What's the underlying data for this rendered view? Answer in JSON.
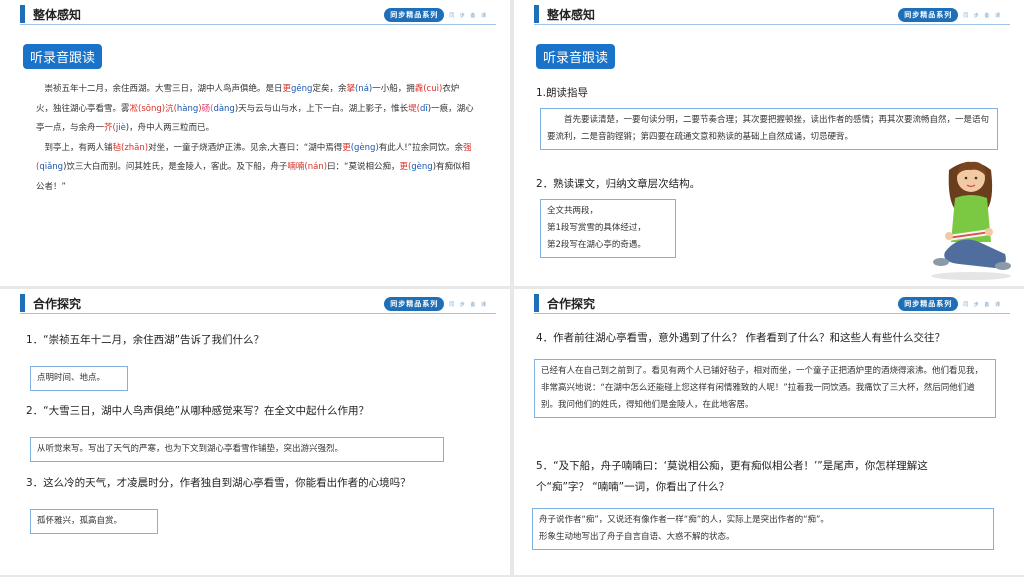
{
  "brand": {
    "tag": "同步精品系列",
    "sub": "同 步 备 课"
  },
  "panel1": {
    "section_title": "整体感知",
    "pill": "听录音跟读",
    "passage": {
      "l1a": "崇祯五年十二月，余住西湖。大雪三日，湖中人鸟声俱绝。是日",
      "l1b": "更",
      "l1c": "gēng",
      "l1d": "定矣，余",
      "l1e": "拏",
      "l1f": "(ná)",
      "l2a": "一小船，拥",
      "l2b": "毳(cuì)",
      "l2c": "衣炉火，独往湖心亭看雪。雾",
      "l2d": "凇(sōng)",
      "l2e": "沆(",
      "l2f": "hàng",
      "l2g": ")",
      "l2h": "砀(",
      "l2i": "dàng",
      "l2j": ")天与云与山",
      "l3a": "与水，上下一白。湖上影子，惟长",
      "l3b": "堤(",
      "l3c": "dī",
      "l3d": ")一痕，湖心亭一点，与余舟一",
      "l3e": "芥(",
      "l3f": "jiè",
      "l3g": ")，舟",
      "l4": "中人两三粒而已。",
      "p2a": "到亭上，有两人铺",
      "p2b": "毡(zhān)",
      "p2c": "对坐，一童子烧酒炉正沸。见余,大喜曰：“湖中焉得",
      "p2d": "更",
      "p2e": "(gèng)",
      "p2f": "有此人!”拉余同饮。余",
      "p2g": "强(",
      "p2h": "qiǎng",
      "p2i": ")饮三大白而别。问其姓氏，是金陵人，客此。",
      "p2j": "及下船，舟子",
      "p2k": "喃喃(nán)",
      "p2l": "曰：“莫说相公痴，",
      "p2m": "更(",
      "p2n": "gèng",
      "p2o": ")有痴似相公者！”"
    }
  },
  "panel2": {
    "section_title": "整体感知",
    "pill": "听录音跟读",
    "q1": "1.朗读指导",
    "a1": "首先要读清楚，一要句读分明，二要节奏合理；其次要把握顿挫，读出作者的感情；再其次要流畅自然，一是语句要流利，二是音韵铿锵；第四要在疏通文意和熟读的基础上自然成诵，切忌硬背。",
    "q2": "2．熟读课文，归纳文章层次结构。",
    "a2_l1": "全文共两段，",
    "a2_l2": "第1段写赏雪的具体经过，",
    "a2_l3": "第2段写在湖心亭的奇遇。"
  },
  "panel3": {
    "section_title": "合作探究",
    "q1": "1．“崇祯五年十二月，余住西湖”告诉了我们什么？",
    "a1": "点明时间、地点。",
    "q2": "2．“大雪三日，湖中人鸟声俱绝”从哪种感觉来写？在全文中起什么作用？",
    "a2": "从听觉来写。写出了天气的严寒，也为下文到湖心亭看雪作铺垫，突出游兴强烈。",
    "q3": "3．这么冷的天气，才凌晨时分，作者独自到湖心亭看雪，你能看出作者的心境吗？",
    "a3": "孤怀雅兴，孤高自赏。"
  },
  "panel4": {
    "section_title": "合作探究",
    "q4": "4．作者前往湖心亭看雪，意外遇到了什么？ 作者看到了什么？和这些人有些什么交往？",
    "a4": "已经有人在自己到之前到了。看见有两个人已铺好毡子，相对而坐，一个童子正把酒炉里的酒烧得滚沸。他们看见我，非常高兴地说：“在湖中怎么还能碰上您这样有闲情雅致的人呢！”拉着我一同饮酒。我痛饮了三大杯，然后同他们道别。我问他们的姓氏，得知他们是金陵人，在此地客居。",
    "q5_l1": "5．“及下船，舟子喃喃曰：‘莫说相公痴，更有痴似相公者！’”是尾声，你怎样理解这",
    "q5_l2": "个“痴”字？ “喃喃”一词，你看出了什么？",
    "a5_l1": "舟子说作者“痴”，又说还有像作者一样“痴”的人，实际上是突出作者的“痴”。",
    "a5_l2": "形象生动地写出了舟子自言自语、大惑不解的状态。"
  }
}
